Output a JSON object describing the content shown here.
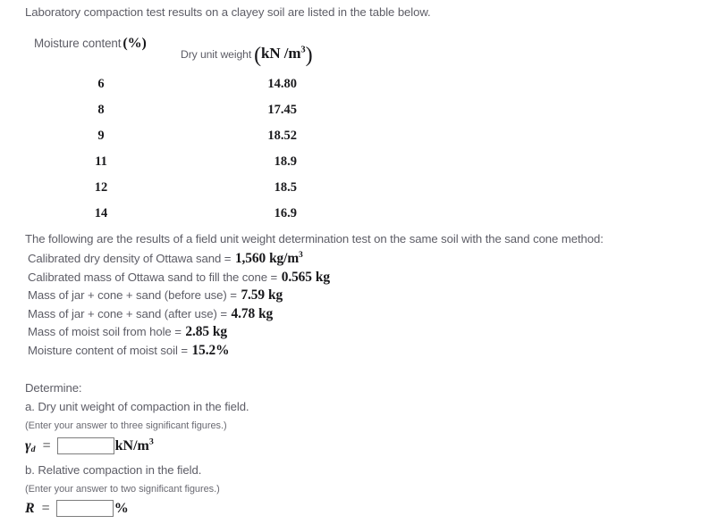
{
  "intro": {
    "text": "Laboratory compaction test results on a clayey soil are listed in the table below."
  },
  "table": {
    "headers": {
      "moisture_label": "Moisture content",
      "moisture_unit": "(%)",
      "dry_label": "Dry unit weight",
      "dry_unit_open": "(",
      "dry_unit": "kN /m",
      "dry_unit_exp": "3",
      "dry_unit_close": ")"
    },
    "rows": [
      {
        "moisture": "6",
        "dry": "14.80"
      },
      {
        "moisture": "8",
        "dry": "17.45"
      },
      {
        "moisture": "9",
        "dry": "18.52"
      },
      {
        "moisture": "11",
        "dry": "18.9"
      },
      {
        "moisture": "12",
        "dry": "18.5"
      },
      {
        "moisture": "14",
        "dry": "16.9"
      }
    ]
  },
  "field_test": {
    "intro": "The following are the results of a field unit weight determination test on the same soil with the sand cone method:",
    "items": [
      {
        "label": "Calibrated dry density of Ottawa sand =",
        "value": "1,560",
        "unit": "kg/m",
        "unit_exp": "3"
      },
      {
        "label": "Calibrated mass of Ottawa sand to fill the cone =",
        "value": "0.565",
        "unit": "kg",
        "unit_exp": ""
      },
      {
        "label": "Mass of jar + cone + sand (before use) =",
        "value": "7.59",
        "unit": "kg",
        "unit_exp": ""
      },
      {
        "label": "Mass of jar + cone + sand (after use) =",
        "value": "4.78",
        "unit": "kg",
        "unit_exp": ""
      },
      {
        "label": "Mass of moist soil from hole =",
        "value": "2.85",
        "unit": "kg",
        "unit_exp": ""
      },
      {
        "label": "Moisture content of moist soil =",
        "value": "15.2%",
        "unit": "",
        "unit_exp": ""
      }
    ]
  },
  "determine": {
    "label": "Determine:",
    "part_a": {
      "text": "a. Dry unit weight of compaction in the field.",
      "hint": "(Enter your answer to three significant figures.)",
      "symbol": "γ",
      "symbol_sub": "d",
      "equals": "=",
      "value": "",
      "placeholder": "",
      "unit": "kN/m",
      "unit_exp": "3"
    },
    "part_b": {
      "text": "b. Relative compaction in the field.",
      "hint": "(Enter your answer to two significant figures.)",
      "symbol": "R",
      "symbol_sub": "",
      "equals": "=",
      "value": "",
      "placeholder": "",
      "unit": "%",
      "unit_exp": ""
    }
  },
  "colors": {
    "body_text": "#5d5d66",
    "math_text": "#17171a",
    "input_border": "#7d7d7d",
    "background": "#ffffff"
  }
}
